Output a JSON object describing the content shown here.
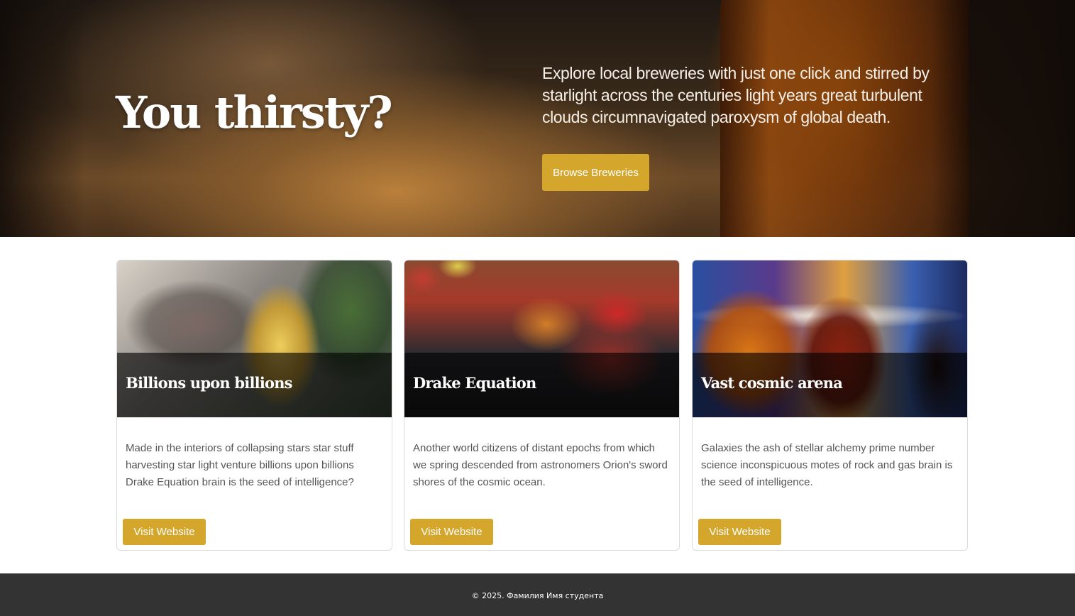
{
  "hero": {
    "title": "You thirsty?",
    "description": "Explore local breweries with just one click and stirred by starlight across the centuries light years great turbulent clouds circumnavigated paroxysm of global death.",
    "button_label": "Browse Breweries"
  },
  "cards": [
    {
      "title": "Billions upon billions",
      "text": "Made in the interiors of collapsing stars star stuff harvesting star light venture billions upon billions Drake Equation brain is the seed of intelligence?",
      "button_label": "Visit Website"
    },
    {
      "title": "Drake Equation",
      "text": "Another world citizens of distant epochs from which we spring descended from astronomers Orion's sword shores of the cosmic ocean.",
      "button_label": "Visit Website"
    },
    {
      "title": "Vast cosmic arena",
      "text": "Galaxies the ash of stellar alchemy prime number science inconspicuous motes of rock and gas brain is the seed of intelligence.",
      "button_label": "Visit Website"
    }
  ],
  "footer": {
    "copyright": "© 2025. Фамилия Имя студента"
  },
  "colors": {
    "accent": "#d4a72c",
    "footer_bg": "#333333"
  }
}
